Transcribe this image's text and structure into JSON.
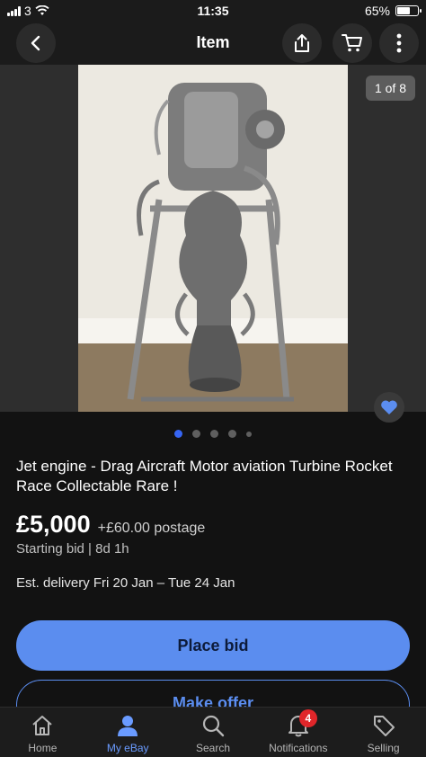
{
  "status_bar": {
    "carrier": "3",
    "time": "11:35",
    "battery": "65%",
    "battery_level": 0.65
  },
  "header": {
    "title": "Item",
    "icons": [
      "back-arrow-icon",
      "share-icon",
      "cart-icon",
      "more-icon"
    ]
  },
  "gallery": {
    "counter": "1 of 8",
    "total_dots": 5,
    "active_dot": 0
  },
  "listing": {
    "title": "Jet engine - Drag Aircraft Motor aviation Turbine Rocket Race Collectable Rare !",
    "price": "£5,000",
    "postage": "+£60.00 postage",
    "bid_info": "Starting bid  |  8d 1h",
    "delivery": "Est. delivery Fri 20 Jan – Tue 24 Jan"
  },
  "actions": {
    "place_bid": "Place bid",
    "make_offer": "Make offer"
  },
  "tabs": [
    {
      "label": "Home",
      "icon": "home-icon"
    },
    {
      "label": "My eBay",
      "icon": "profile-icon",
      "active": true
    },
    {
      "label": "Search",
      "icon": "search-icon"
    },
    {
      "label": "Notifications",
      "icon": "bell-icon",
      "badge": "4"
    },
    {
      "label": "Selling",
      "icon": "tag-icon"
    }
  ],
  "colors": {
    "accent": "#3665f3",
    "button": "#5b8def",
    "badge": "#e0262a",
    "background": "#121212"
  }
}
